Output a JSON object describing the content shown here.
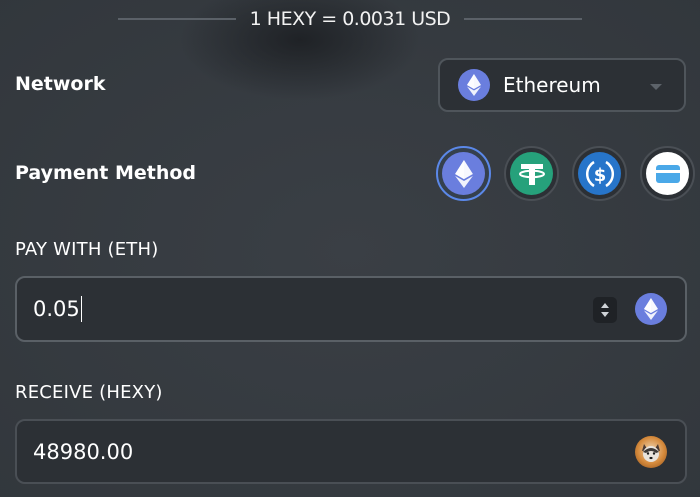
{
  "rate": {
    "text": "1 HEXY = 0.0031 USD"
  },
  "network": {
    "label": "Network",
    "selected": "Ethereum"
  },
  "payment_method": {
    "label": "Payment Method",
    "options": [
      "eth-icon",
      "usdt-icon",
      "usdc-icon",
      "card-icon"
    ],
    "selected": "eth-icon"
  },
  "pay": {
    "label": "PAY WITH (ETH)",
    "value": "0.05"
  },
  "receive": {
    "label": "RECEIVE (HEXY)",
    "value": "48980.00"
  },
  "colors": {
    "eth": "#6a7ede",
    "usdt": "#26a17b",
    "usdc": "#2775ca",
    "selected_border": "#5b88e8",
    "background": "#34393e"
  }
}
